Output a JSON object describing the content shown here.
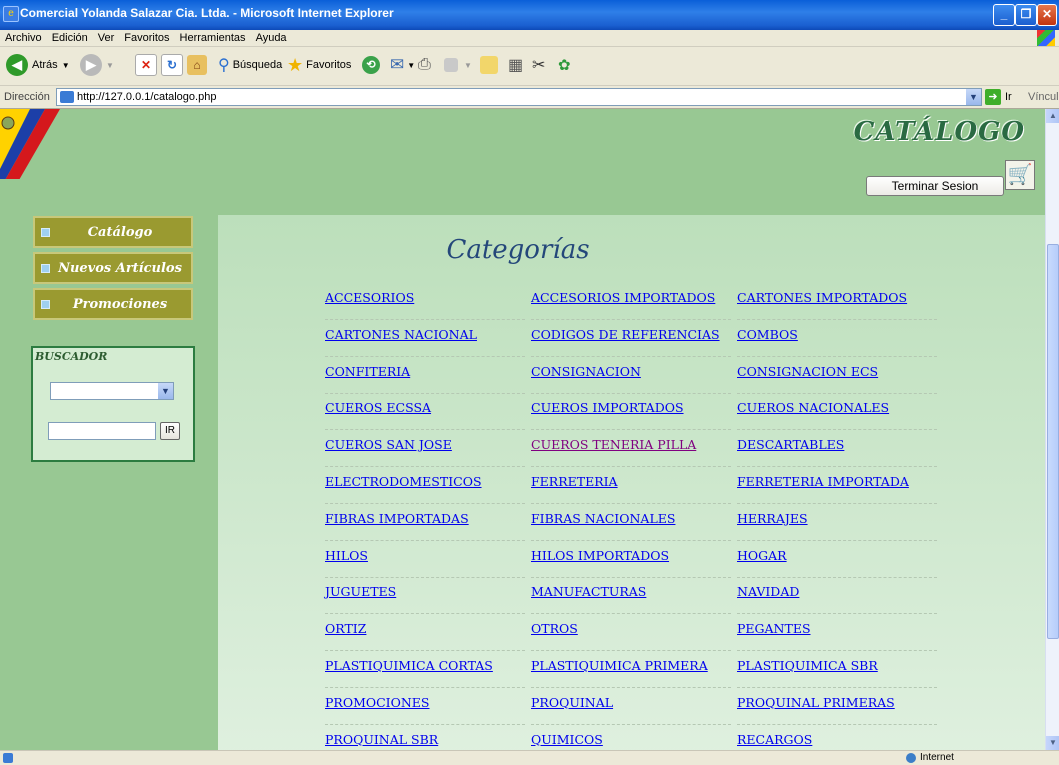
{
  "window": {
    "title": "Comercial Yolanda Salazar Cia. Ltda. - Microsoft Internet Explorer"
  },
  "menu": [
    "Archivo",
    "Edición",
    "Ver",
    "Favoritos",
    "Herramientas",
    "Ayuda"
  ],
  "toolbar": {
    "back_label": "Atrás",
    "search_label": "Búsqueda",
    "favorites_label": "Favoritos"
  },
  "address": {
    "label": "Dirección",
    "url": "http://127.0.0.1/catalogo.php",
    "go_label": "Ir",
    "links_label": "Vínculos"
  },
  "page": {
    "title": "CATÁLOGO",
    "logout_label": "Terminar Sesion",
    "left_menu": [
      "Catálogo",
      "Nuevos Artículos",
      "Promociones"
    ],
    "search": {
      "label": "BUSCADOR",
      "go_label": "IR"
    },
    "heading": "Categorías",
    "categories": [
      [
        "ACCESORIOS",
        "ACCESORIOS IMPORTADOS",
        "CARTONES IMPORTADOS"
      ],
      [
        "CARTONES NACIONAL",
        "CODIGOS DE REFERENCIAS",
        "COMBOS"
      ],
      [
        "CONFITERIA",
        "CONSIGNACION",
        "CONSIGNACION ECS"
      ],
      [
        "CUEROS ECSSA",
        "CUEROS IMPORTADOS",
        "CUEROS NACIONALES"
      ],
      [
        "CUEROS SAN JOSE",
        "CUEROS TENERIA PILLA",
        "DESCARTABLES"
      ],
      [
        "ELECTRODOMESTICOS",
        "FERRETERIA",
        "FERRETERIA IMPORTADA"
      ],
      [
        "FIBRAS IMPORTADAS",
        "FIBRAS NACIONALES",
        "HERRAJES"
      ],
      [
        "HILOS",
        "HILOS IMPORTADOS",
        "HOGAR"
      ],
      [
        "JUGUETES",
        "MANUFACTURAS",
        "NAVIDAD"
      ],
      [
        "ORTIZ",
        "OTROS",
        "PEGANTES"
      ],
      [
        "PLASTIQUIMICA CORTAS",
        "PLASTIQUIMICA PRIMERA",
        "PLASTIQUIMICA SBR"
      ],
      [
        "PROMOCIONES",
        "PROQUINAL",
        "PROQUINAL PRIMERAS"
      ],
      [
        "PROQUINAL SBR",
        "QUIMICOS",
        "RECARGOS"
      ]
    ],
    "visited": "CUEROS TENERIA PILLA"
  },
  "status": {
    "zone": "Internet"
  }
}
